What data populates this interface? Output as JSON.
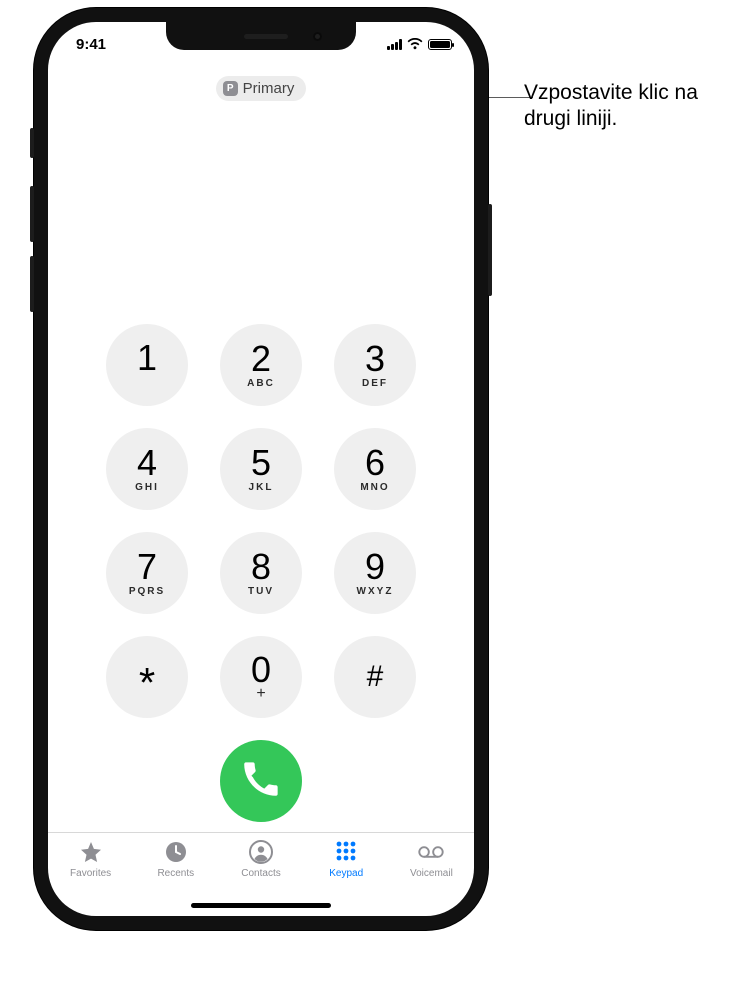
{
  "status": {
    "time": "9:41"
  },
  "sim": {
    "badge_letter": "P",
    "label": "Primary"
  },
  "keys": [
    {
      "digit": "1",
      "letters": ""
    },
    {
      "digit": "2",
      "letters": "ABC"
    },
    {
      "digit": "3",
      "letters": "DEF"
    },
    {
      "digit": "4",
      "letters": "GHI"
    },
    {
      "digit": "5",
      "letters": "JKL"
    },
    {
      "digit": "6",
      "letters": "MNO"
    },
    {
      "digit": "7",
      "letters": "PQRS"
    },
    {
      "digit": "8",
      "letters": "TUV"
    },
    {
      "digit": "9",
      "letters": "WXYZ"
    },
    {
      "digit": "*",
      "letters": ""
    },
    {
      "digit": "0",
      "letters": "+"
    },
    {
      "digit": "#",
      "letters": ""
    }
  ],
  "tabs": {
    "favorites": "Favorites",
    "recents": "Recents",
    "contacts": "Contacts",
    "keypad": "Keypad",
    "voicemail": "Voicemail"
  },
  "callout": {
    "text": "Vzpostavite klic na drugi liniji."
  }
}
